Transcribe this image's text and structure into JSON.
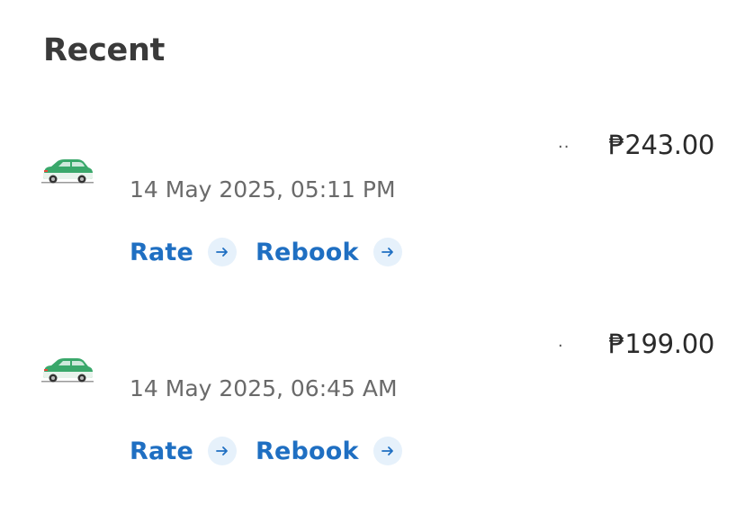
{
  "section": {
    "title": "Recent"
  },
  "rides": [
    {
      "icon": "car-icon",
      "destination": "",
      "more": "..",
      "price": "₱243.00",
      "datetime": "14 May 2025, 05:11 PM",
      "rate_label": "Rate",
      "rebook_label": "Rebook"
    },
    {
      "icon": "car-icon",
      "destination": "",
      "more": ".",
      "price": "₱199.00",
      "datetime": "14 May 2025, 06:45 AM",
      "rate_label": "Rate",
      "rebook_label": "Rebook"
    }
  ],
  "colors": {
    "accent": "#1f6fc2",
    "accent_bg": "#e6f1fb",
    "car_green": "#3aa86b"
  }
}
